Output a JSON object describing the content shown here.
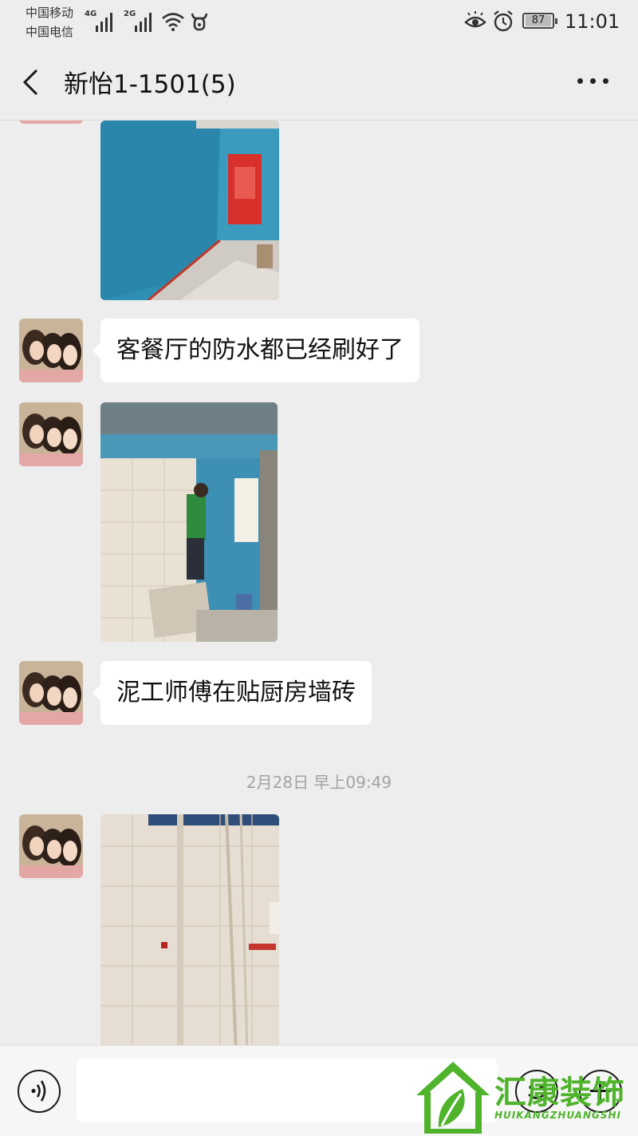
{
  "status_bar": {
    "carrier_1": "中国移动",
    "carrier_2": "中国电信",
    "net_1": "4G",
    "net_2": "2G",
    "battery": "87",
    "time": "11:01"
  },
  "header": {
    "title": "新怡1-1501(5)",
    "back_icon": "chevron-left-icon",
    "more_icon": "more-dots-icon"
  },
  "messages": [
    {
      "type": "image",
      "content": "photo-blue-waterproofed-room"
    },
    {
      "type": "text",
      "text": "客餐厅的防水都已经刷好了"
    },
    {
      "type": "image",
      "content": "photo-worker-tiling-kitchen"
    },
    {
      "type": "text",
      "text": "泥工师傅在贴厨房墙砖"
    },
    {
      "type": "timestamp",
      "text": "2月28日 早上09:49"
    },
    {
      "type": "image",
      "content": "photo-tiled-wall"
    }
  ],
  "input_bar": {
    "voice_icon": "voice-icon",
    "input_value": "",
    "emoji_icon": "emoji-icon",
    "plus_icon": "plus-icon"
  },
  "watermark": {
    "brand": "汇康装饰",
    "brand_en": "HUIKANGZHUANGSHI"
  },
  "colors": {
    "background": "#ededed",
    "bubble": "#ffffff",
    "watermark_green": "#4fb32c"
  }
}
